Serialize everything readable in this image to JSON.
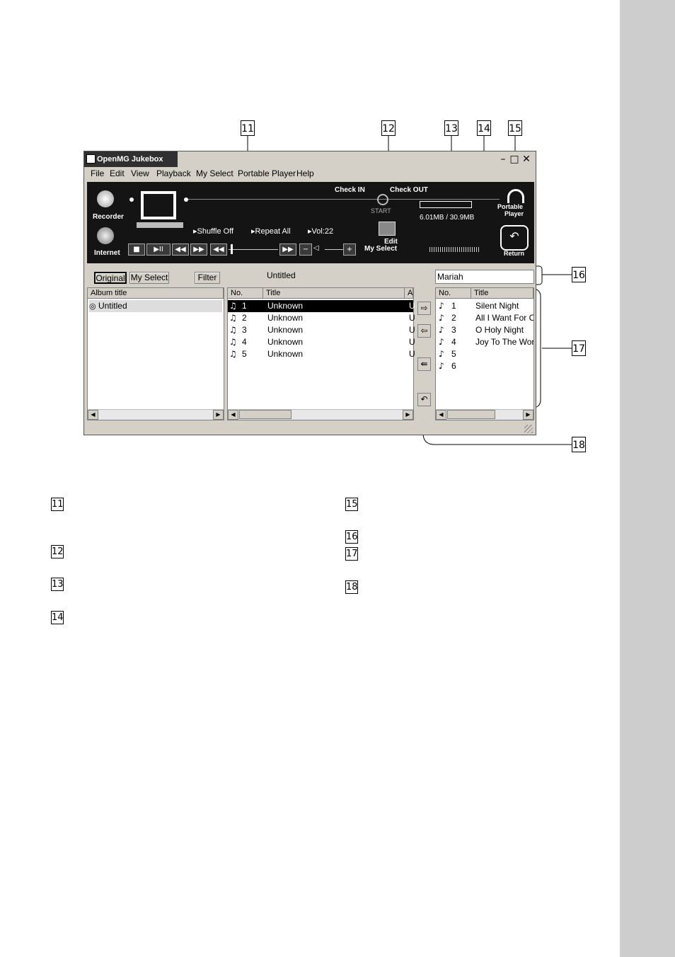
{
  "callouts": [
    "11",
    "12",
    "13",
    "14",
    "15",
    "16",
    "17",
    "18"
  ],
  "legend_left": [
    "11",
    "12",
    "13",
    "14"
  ],
  "legend_right": [
    "15",
    "16",
    "17",
    "18"
  ],
  "window": {
    "title": "OpenMG Jukebox",
    "controls": {
      "minimize": "–",
      "maximize": "□",
      "close": "✕"
    }
  },
  "menu": [
    "File",
    "Edit",
    "View",
    "Playback",
    "My Select",
    "Portable Player",
    "Help"
  ],
  "player": {
    "recorder_label": "Recorder",
    "internet_label": "Internet",
    "check_in": "Check IN",
    "check_out": "Check OUT",
    "start": "START",
    "shuffle": "Shuffle Off",
    "repeat": "Repeat All",
    "volume": "Vol:22",
    "edit_my_select_line1": "Edit",
    "edit_my_select_line2": "My Select",
    "capacity": "6.01MB / 30.9MB",
    "portable_line1": "Portable",
    "portable_line2": "Player",
    "return_label": "Return"
  },
  "toolbar": {
    "original": "Original",
    "my_select": "My Select",
    "filter": "Filter",
    "current_album": "Untitled",
    "portable_name": "Mariah"
  },
  "album_list": {
    "header": "Album title",
    "items": [
      "Untitled"
    ]
  },
  "track_list": {
    "headers": [
      "No.",
      "Title",
      "A"
    ],
    "rows": [
      {
        "no": "1",
        "title": "Unknown",
        "a": "U"
      },
      {
        "no": "2",
        "title": "Unknown",
        "a": "U"
      },
      {
        "no": "3",
        "title": "Unknown",
        "a": "U"
      },
      {
        "no": "4",
        "title": "Unknown",
        "a": "U"
      },
      {
        "no": "5",
        "title": "Unknown",
        "a": "U"
      }
    ]
  },
  "portable_list": {
    "headers": [
      "No.",
      "Title"
    ],
    "rows": [
      {
        "no": "1",
        "title": "Silent Night"
      },
      {
        "no": "2",
        "title": "All I Want For C.."
      },
      {
        "no": "3",
        "title": "O Holy Night"
      },
      {
        "no": "4",
        "title": "Joy To The Worl"
      },
      {
        "no": "5",
        "title": ""
      },
      {
        "no": "6",
        "title": ""
      }
    ]
  }
}
